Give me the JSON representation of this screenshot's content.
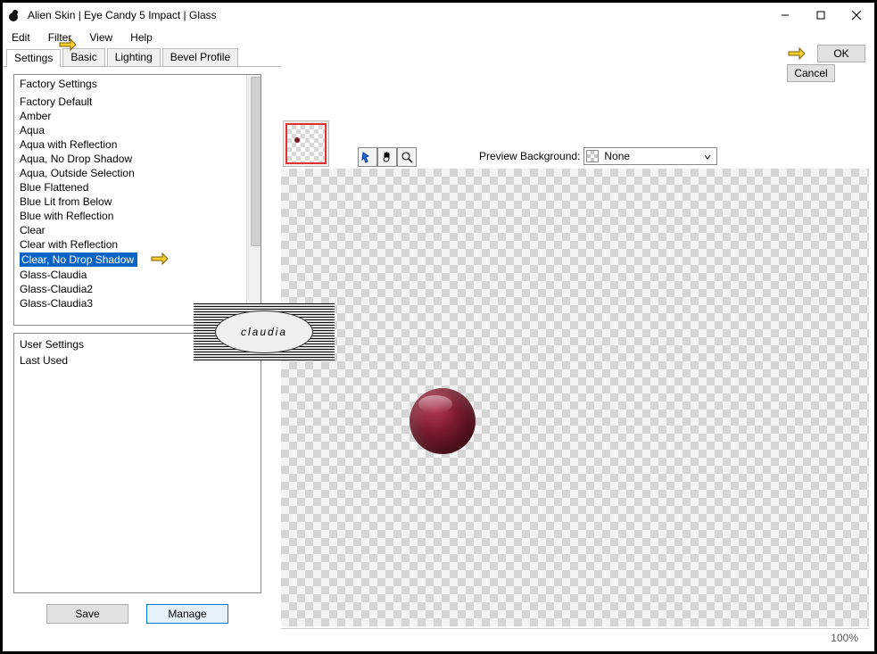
{
  "window": {
    "title": "Alien Skin | Eye Candy 5 Impact | Glass"
  },
  "menubar": {
    "edit": "Edit",
    "filter": "Filter",
    "view": "View",
    "help": "Help"
  },
  "tabs": {
    "settings": "Settings",
    "basic": "Basic",
    "lighting": "Lighting",
    "bevel_profile": "Bevel Profile"
  },
  "buttons": {
    "ok": "OK",
    "cancel": "Cancel",
    "save": "Save",
    "manage": "Manage"
  },
  "factory_list": {
    "header": "Factory Settings",
    "items": [
      "Factory Default",
      "Amber",
      "Aqua",
      "Aqua with Reflection",
      "Aqua, No Drop Shadow",
      "Aqua, Outside Selection",
      "Blue Flattened",
      "Blue Lit from Below",
      "Blue with Reflection",
      "Clear",
      "Clear with Reflection",
      "Clear, No Drop Shadow",
      "Glass-Claudia",
      "Glass-Claudia2",
      "Glass-Claudia3"
    ],
    "selected_index": 11
  },
  "user_list": {
    "header": "User Settings",
    "items": [
      "Last Used"
    ]
  },
  "preview": {
    "label": "Preview Background:",
    "value": "None"
  },
  "status": {
    "zoom": "100%"
  },
  "watermark": "claudia"
}
